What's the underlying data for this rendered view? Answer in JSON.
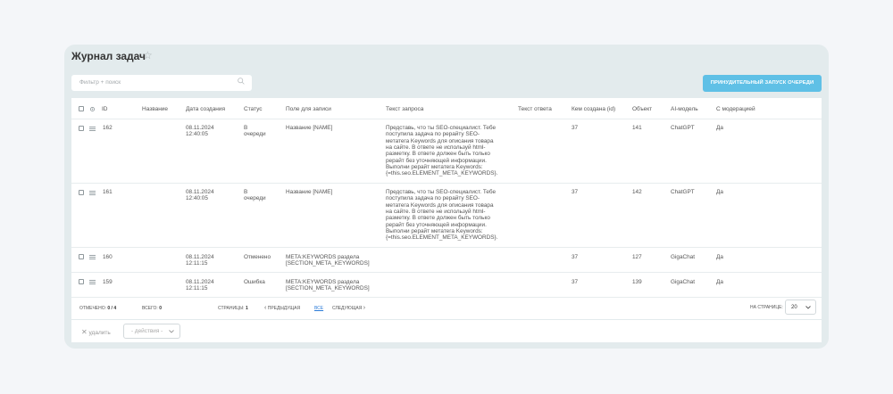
{
  "page": {
    "title": "Журнал задач",
    "star_icon": "star-icon"
  },
  "filter": {
    "placeholder": "Фильтр + поиск"
  },
  "toolbar": {
    "run_queue_label": "Принудительный запуск очереди"
  },
  "table": {
    "columns": [
      "ID",
      "Название",
      "Дата создания",
      "Статус",
      "Поле для записи",
      "Текст запроса",
      "Текст ответа",
      "Кем создана (id)",
      "Объект",
      "AI-модель",
      "С модерацией"
    ],
    "rows": [
      {
        "id": "162",
        "name": "",
        "date": "08.11.2024",
        "time": "12:40:05",
        "status_l1": "В",
        "status_l2": "очереди",
        "field_l1": "Название [NAME]",
        "field_l2": "",
        "query": [
          "Представь, что ты SEO-специалист. Тебе",
          "поступила задача по рерайту SEO-",
          "метатега Keywords для описания товара",
          "на сайте. В ответе не используй html-",
          "разметку. В ответе должен быть только",
          "рерайт без уточняющей информации.",
          "Выполни рерайт метатега Keywords:",
          "{=this.seo.ELEMENT_META_KEYWORDS}."
        ],
        "answer": "",
        "creator": "37",
        "object": "141",
        "model": "ChatGPT",
        "moderation": "Да"
      },
      {
        "id": "161",
        "name": "",
        "date": "08.11.2024",
        "time": "12:40:05",
        "status_l1": "В",
        "status_l2": "очереди",
        "field_l1": "Название [NAME]",
        "field_l2": "",
        "query": [
          "Представь, что ты SEO-специалист. Тебе",
          "поступила задача по рерайту SEO-",
          "метатега Keywords для описания товара",
          "на сайте. В ответе не используй html-",
          "разметку. В ответе должен быть только",
          "рерайт без уточняющей информации.",
          "Выполни рерайт метатега Keywords:",
          "{=this.seo.ELEMENT_META_KEYWORDS}."
        ],
        "answer": "",
        "creator": "37",
        "object": "142",
        "model": "ChatGPT",
        "moderation": "Да"
      },
      {
        "id": "160",
        "name": "",
        "date": "08.11.2024",
        "time": "12:11:15",
        "status_l1": "Отменено",
        "status_l2": "",
        "field_l1": "META:KEYWORDS раздела",
        "field_l2": "[SECTION_META_KEYWORDS]",
        "query": [],
        "answer": "",
        "creator": "37",
        "object": "127",
        "model": "GigaChat",
        "moderation": "Да"
      },
      {
        "id": "159",
        "name": "",
        "date": "08.11.2024",
        "time": "12:11:15",
        "status_l1": "Ошибка",
        "status_l2": "",
        "field_l1": "META:KEYWORDS раздела",
        "field_l2": "[SECTION_META_KEYWORDS]",
        "query": [],
        "answer": "",
        "creator": "37",
        "object": "139",
        "model": "GigaChat",
        "moderation": "Да"
      }
    ]
  },
  "footer": {
    "selected_label": "Отмечено:",
    "selected_value": "0 / 4",
    "total_label": "Всего:",
    "total_value": "0",
    "pages_label": "Страницы:",
    "pages_value": "1",
    "prev_label": "Предыдущая",
    "all_label": "Все",
    "next_label": "Следующая",
    "per_page_label": "На странице:",
    "per_page_value": "20"
  },
  "actions": {
    "delete_label": "удалить",
    "actions_placeholder": "- действия -"
  }
}
